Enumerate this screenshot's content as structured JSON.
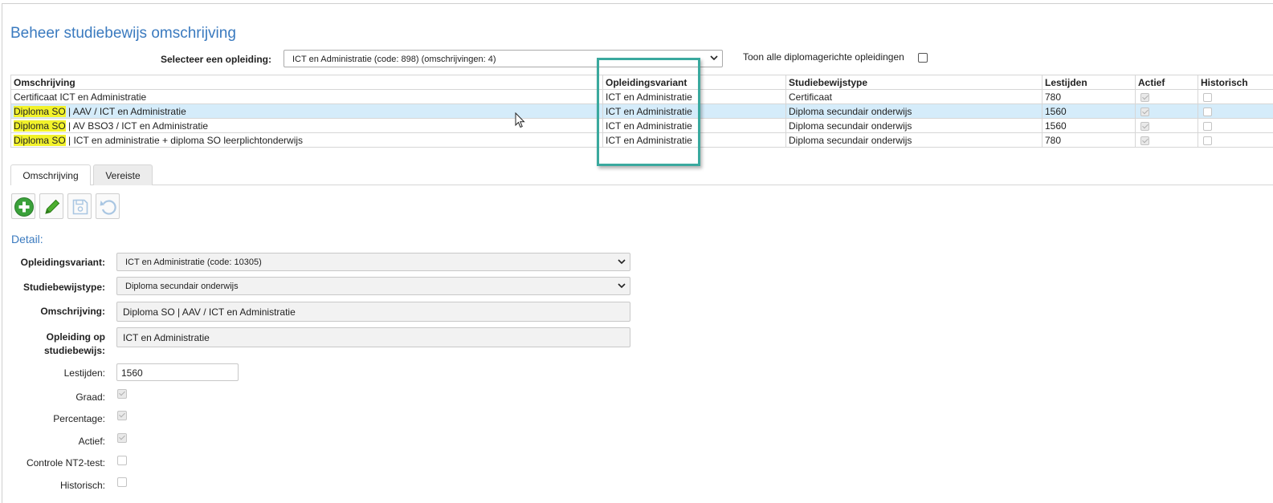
{
  "page_title": "Beheer studiebewijs omschrijving",
  "selector": {
    "label": "Selecteer een opleiding:",
    "value": "ICT en Administratie (code: 898) (omschrijvingen: 4)",
    "toggle_label": "Toon alle diplomagerichte opleidingen",
    "toggle_checked": false
  },
  "grid": {
    "columns": [
      "Omschrijving",
      "Opleidingsvariant",
      "Studiebewijstype",
      "Lestijden",
      "Actief",
      "Historisch"
    ],
    "rows": [
      {
        "highlight": "",
        "description": "Certificaat ICT en Administratie",
        "variant": "ICT en Administratie",
        "type": "Certificaat",
        "hours": "780",
        "active": true,
        "historic": false
      },
      {
        "highlight": "Diploma SO",
        "description": " | AAV / ICT en Administratie",
        "variant": "ICT en Administratie",
        "type": "Diploma secundair onderwijs",
        "hours": "1560",
        "active": true,
        "historic": false
      },
      {
        "highlight": "Diploma SO",
        "description": " | AV BSO3 / ICT en Administratie",
        "variant": "ICT en Administratie",
        "type": "Diploma secundair onderwijs",
        "hours": "1560",
        "active": true,
        "historic": false
      },
      {
        "highlight": "Diploma SO",
        "description": " | ICT en administratie + diploma SO leerplichtonderwijs",
        "variant": "ICT en Administratie",
        "type": "Diploma secundair onderwijs",
        "hours": "780",
        "active": true,
        "historic": false
      }
    ],
    "selected_row": 1
  },
  "tabs": [
    {
      "label": "Omschrijving",
      "active": true
    },
    {
      "label": "Vereiste",
      "active": false
    }
  ],
  "toolbar": {
    "add_icon": "plus-circle-icon",
    "edit_icon": "pencil-icon",
    "save_icon": "floppy-disk-icon",
    "undo_icon": "undo-icon"
  },
  "detail": {
    "heading": "Detail:",
    "variant_label": "Opleidingsvariant:",
    "variant_value": "ICT en Administratie (code: 10305)",
    "type_label": "Studiebewijstype:",
    "type_value": "Diploma secundair onderwijs",
    "description_label": "Omschrijving:",
    "description_value": "Diploma SO | AAV / ICT en Administratie",
    "education_label_1": "Opleiding op",
    "education_label_2": "studiebewijs:",
    "education_value": "ICT en Administratie",
    "hours_label": "Lestijden:",
    "hours_value": "1560",
    "grade_label": "Graad:",
    "grade_checked": true,
    "percentage_label": "Percentage:",
    "percentage_checked": true,
    "active_label": "Actief:",
    "active_checked": true,
    "nt2_label": "Controle NT2-test:",
    "nt2_checked": false,
    "historic_label": "Historisch:",
    "historic_checked": false
  },
  "colors": {
    "title_blue": "#3a7abf",
    "highlight_yellow": "#f2f22a",
    "selected_row": "#d5ecfa",
    "callout_teal": "#3aa99e",
    "add_green": "#3aa13a"
  }
}
